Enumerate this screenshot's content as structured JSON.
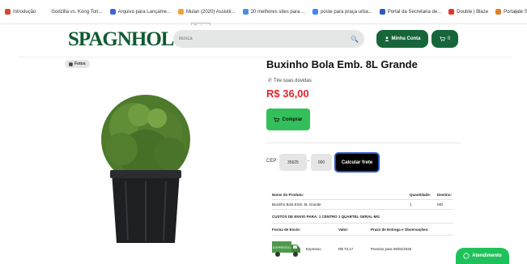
{
  "bookmarks": [
    {
      "label": "Introdução",
      "color": "#d9442e"
    },
    {
      "label": "Godzilla vs. Kong Torr...",
      "color": "#ffffff"
    },
    {
      "label": "Arquivo para Lançame...",
      "color": "#3a67d6"
    },
    {
      "label": "Mulan (2020) Assistir...",
      "color": "#f2a23b"
    },
    {
      "label": "20 melhores sites para ...",
      "color": "#4a8fe0"
    },
    {
      "label": "poste para praça urba...",
      "color": "#4285f4"
    },
    {
      "label": "Portal da Secretaria de...",
      "color": "#2a5bbf"
    },
    {
      "label": "Double | Blaze",
      "color": "#e8352a"
    },
    {
      "label": "Portal de Solicitações",
      "color": "#d8832a"
    }
  ],
  "bookmarks_more": "»",
  "tooltip": "Fechar",
  "header": {
    "logo": "SPAGNHOL",
    "search_placeholder": "Busca",
    "account_label": "Minha Conta",
    "cart_count": "0"
  },
  "gallery": {
    "photos_label": "Fotos"
  },
  "product": {
    "title": "Buxinho Bola Emb. 8L Grande",
    "question_label": "Tire suas dúvidas",
    "price": "R$ 36,00",
    "buy_label": "Comprar"
  },
  "cep": {
    "label": "CEP:",
    "part1": "35625",
    "separator": "-",
    "part2": "000",
    "calc_label": "Calcular frete"
  },
  "shipping": {
    "headers": {
      "name": "Nome do Produto:",
      "qty": "Quantidade:",
      "dest": "Destino:"
    },
    "product_row": {
      "name": "Buxinho Bola Emb. 8L Grande",
      "qty": "1",
      "dest": "MG"
    },
    "route_title": "CUSTOS DE ENVIO PARA: 1 CENTRO 1 QUARTEL GERAL-MG",
    "method_headers": {
      "method": "Forma de Envio:",
      "value": "Valor:",
      "deadline": "Prazo de Entrega e Observações:"
    },
    "method_row": {
      "method": "Expresso",
      "value": "R$ 72,17",
      "deadline": "Previsto para 09/02/2026",
      "truck_text": "EXPRESSO"
    }
  },
  "whatsapp_label": "Atendimento",
  "colors": {
    "brand_green": "#16663a",
    "buy_green": "#33c05a",
    "price_red": "#e0262f",
    "whatsapp": "#1fc25a"
  }
}
